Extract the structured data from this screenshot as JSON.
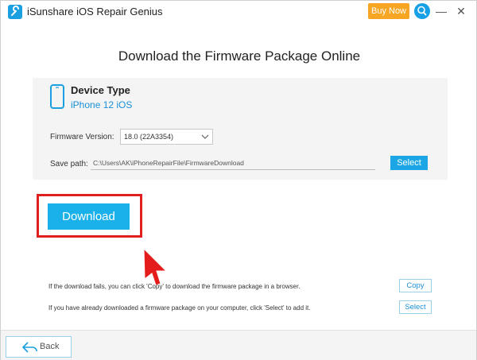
{
  "window": {
    "app_title": "iSunshare iOS Repair Genius",
    "buy_now_label": "Buy Now",
    "minimize_glyph": "—",
    "close_glyph": "✕"
  },
  "page": {
    "title": "Download the Firmware Package Online"
  },
  "device": {
    "type_label": "Device Type",
    "model": "iPhone 12  iOS"
  },
  "firmware": {
    "label": "Firmware Version:",
    "selected_version": "18.0 (22A3354)"
  },
  "save": {
    "label": "Save path:",
    "path_value": "C:\\Users\\AK\\iPhoneRepairFile\\FirmwareDownload",
    "select_label": "Select"
  },
  "download": {
    "button_label": "Download"
  },
  "help": {
    "copy_text": "If the download fails, you can click 'Copy' to download the firmware package in a browser.",
    "copy_label": "Copy",
    "select_text": "If you have already downloaded a firmware package on your computer, click 'Select' to add it.",
    "select_label": "Select"
  },
  "footer": {
    "back_label": "Back"
  },
  "colors": {
    "accent_blue": "#1ab0ea",
    "buy_now_orange": "#f6a623",
    "highlight_red": "#e02020"
  },
  "icons": {
    "app_logo": "wrench-app-icon",
    "search": "search-icon",
    "device": "phone-icon",
    "chevron": "chevron-down-icon",
    "back": "back-arrow-icon",
    "pointer": "red-pointer-cursor-icon"
  }
}
